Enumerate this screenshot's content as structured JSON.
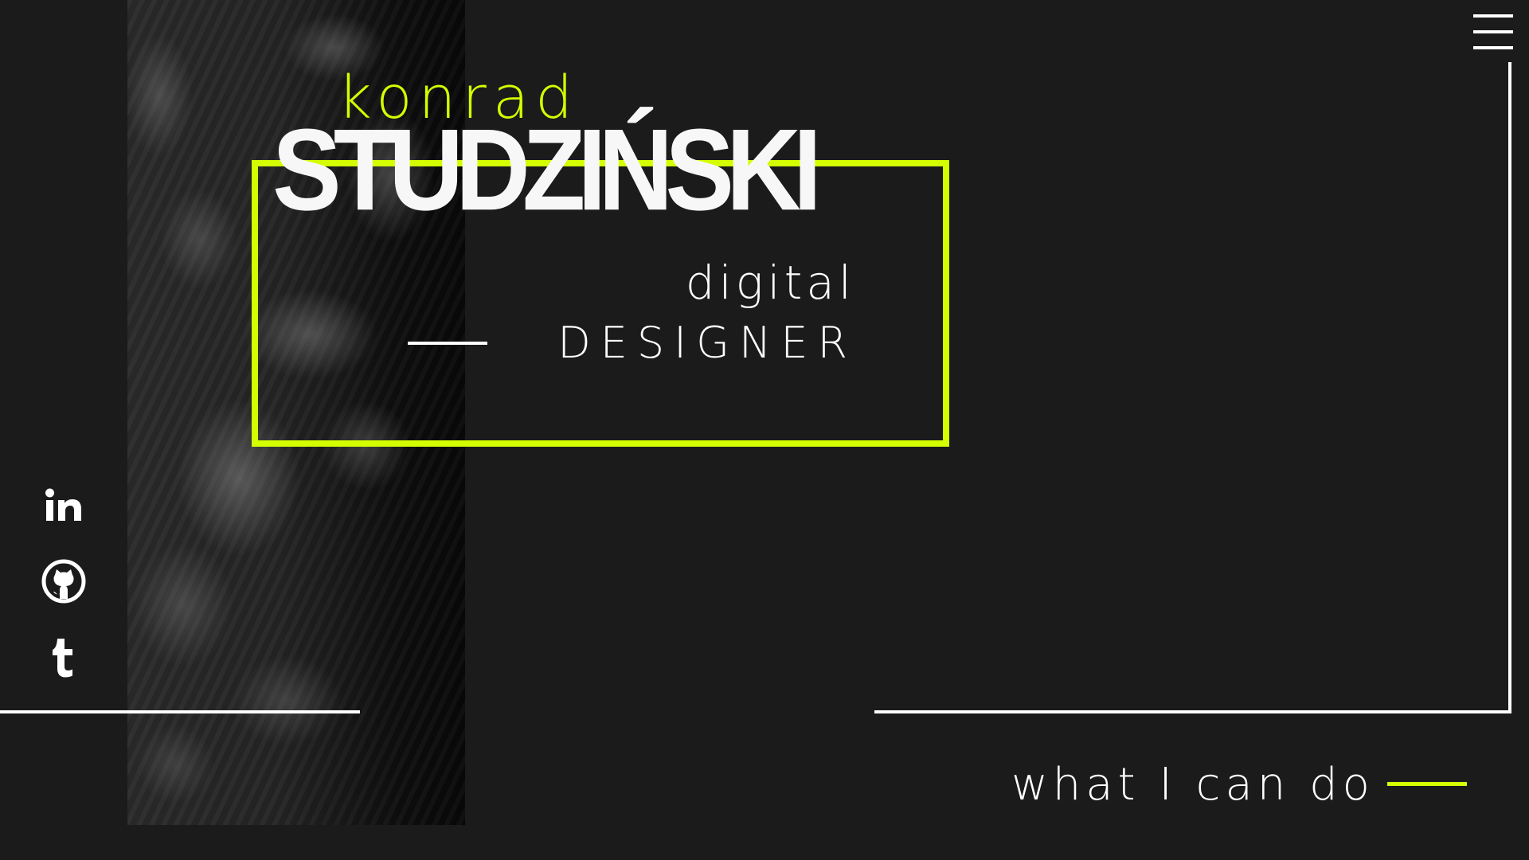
{
  "hero": {
    "first_name": "konrad",
    "last_name": "STUDZIŃSKI",
    "role_line1": "digital",
    "role_line2": "DESIGNER"
  },
  "social": {
    "items": [
      {
        "name": "linkedin",
        "icon": "linkedin-icon"
      },
      {
        "name": "github",
        "icon": "github-icon"
      },
      {
        "name": "tumblr",
        "icon": "tumblr-icon"
      }
    ]
  },
  "cta": {
    "label": "what I can do"
  },
  "menu": {
    "icon": "hamburger-menu-icon"
  },
  "colors": {
    "background": "#1b1b1b",
    "accent": "#d4ff00",
    "text": "#ffffff"
  }
}
